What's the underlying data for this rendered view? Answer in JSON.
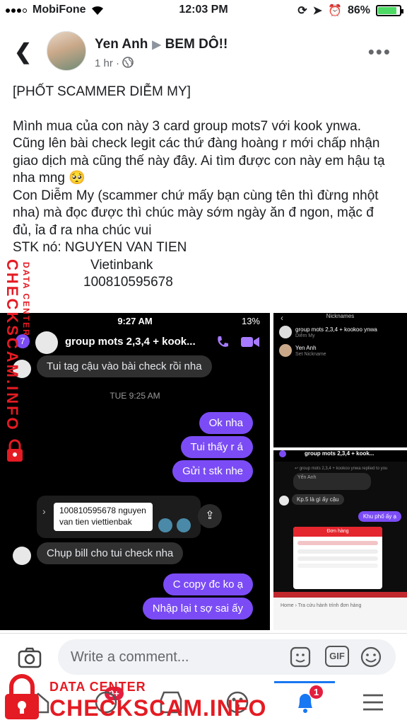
{
  "status_bar": {
    "carrier": "MobiFone",
    "time": "12:03 PM",
    "battery": "86%",
    "battery_level": 0.86
  },
  "header": {
    "author": "Yen Anh",
    "group": "BEM DÔ!!",
    "timestamp": "1 hr",
    "privacy_icon": "globe-icon"
  },
  "post": {
    "title": "[PHỐT SCAMMER DIỄM MY]",
    "paragraph1": "Mình mua của con này 3 card group mots7 với kook ynwa. Cũng lên bài check legit các thứ đàng hoàng r mới chấp nhận giao dịch mà cũng thế này đây. Ai tìm được con này em hậu tạ nha mng 🥺",
    "paragraph2": "Con Diễm My (scammer chứ mấy bạn cùng tên thì đừng nhột nha) mà đọc được thì chúc mày sớm ngày ăn đ ngon, mặc đ đủ, ỉa đ ra nha chúc vui",
    "stk_line": "STK nó: NGUYEN VAN TIEN",
    "bank": "Vietinbank",
    "account": "100810595678"
  },
  "screenshot_main": {
    "time": "9:27 AM",
    "battery": "13%",
    "unread": "7",
    "chat_title": "group mots 2,3,4 + kook...",
    "msg1": "Tui tag cậu vào bài check rồi nha",
    "date_sep": "TUE 9:25 AM",
    "out1": "Ok nha",
    "out2": "Tui thấy r á",
    "out3": "Gửi t stk nhe",
    "account_msg_line1": "100810595678 nguyen",
    "account_msg_line2": "van tien viettienbak",
    "msg2": "Chụp bill cho tui check nha",
    "out4": "C copy đc ko ạ",
    "out5": "Nhập lại t sợ sai ấy"
  },
  "screenshot_side1": {
    "title": "Nicknames",
    "row1_name": "group mots 2,3,4 + kookoo ynwa",
    "row1_sub": "Diễm My",
    "row2_name": "Yen Anh",
    "row2_sub": "Set Nickname"
  },
  "screenshot_side2": {
    "chat_title": "group mots 2,3,4 + kook...",
    "reply_note": "↩ group mots 2,3,4 + kookoo ynwa replied to you",
    "quoted": "Yến Anh",
    "msg1": "Kp.5 là gì ấy cậu",
    "out1": "Khu phố ấy ạ",
    "order_title": "Đơn hàng",
    "breadcrumb": "Home › Tra cứu hành trình đơn hàng"
  },
  "watermark": {
    "data_center": "DATA CENTER",
    "checkscam": "CHECKSCAM.INFO"
  },
  "comment_bar": {
    "placeholder": "Write a comment...",
    "gif": "GIF"
  },
  "tab_bar": {
    "badge_home": "9+",
    "badge_notifications": "1"
  },
  "colors": {
    "messenger_purple": "#7b4cf5",
    "watermark_red": "#e41b23",
    "facebook_blue": "#1877f2"
  }
}
